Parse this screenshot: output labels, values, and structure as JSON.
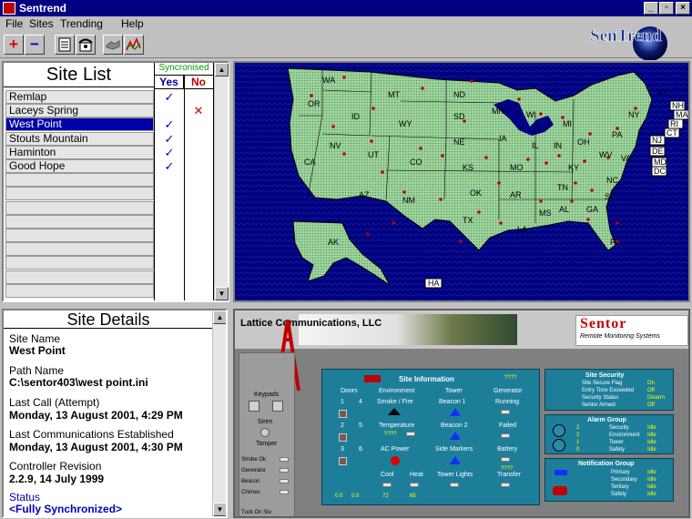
{
  "window": {
    "title": "Sentrend"
  },
  "menu": [
    "File",
    "Sites",
    "Trending",
    "Help"
  ],
  "toolbar": {
    "add": "+",
    "remove": "−"
  },
  "brand": "SenTrend",
  "site_list": {
    "title": "Site List",
    "sync_header": "Syncronised",
    "yes_label": "Yes",
    "no_label": "No",
    "sites": [
      {
        "name": "Remlap",
        "sync": "yes"
      },
      {
        "name": "Laceys Spring",
        "sync": "no"
      },
      {
        "name": "West Point",
        "sync": "yes",
        "selected": true
      },
      {
        "name": "Stouts Mountain",
        "sync": "yes"
      },
      {
        "name": "Haminton",
        "sync": "yes"
      },
      {
        "name": "Good Hope",
        "sync": "yes"
      }
    ],
    "check_glyph": "✓",
    "cross_glyph": "✕"
  },
  "map": {
    "states": [
      "WA",
      "OR",
      "ID",
      "MT",
      "ND",
      "SD",
      "MN",
      "WI",
      "MI",
      "NY",
      "VT",
      "NH",
      "MA",
      "RI",
      "CT",
      "NJ",
      "DE",
      "MD",
      "DC",
      "CA",
      "NV",
      "UT",
      "WY",
      "NE",
      "IA",
      "IL",
      "IN",
      "OH",
      "PA",
      "WV",
      "VA",
      "KY",
      "CO",
      "KS",
      "MO",
      "TN",
      "NC",
      "SC",
      "GA",
      "AL",
      "MS",
      "AR",
      "OK",
      "TX",
      "LA",
      "FL",
      "AZ",
      "NM",
      "AK",
      "HA"
    ],
    "land_color": "#9bd19a",
    "water_color": "#000080"
  },
  "site_details": {
    "title": "Site Details",
    "site_name_label": "Site Name",
    "site_name": "West Point",
    "path_name_label": "Path Name",
    "path_name": "C:\\sentor403\\west point.ini",
    "last_call_label": "Last Call (Attempt)",
    "last_call": "Monday, 13 August 2001, 4:29 PM",
    "last_comm_label": "Last Communications Established",
    "last_comm": "Monday, 13 August 2001, 4:30 PM",
    "controller_label": "Controller Revision",
    "controller": "2.2.9, 14 July 1999",
    "status_label": "Status",
    "status": "<Fully Synchronized>"
  },
  "remote": {
    "company": "Lattice Communications, LLC",
    "logo": "Sentor",
    "logo_sub": "Remote Monitoring Systems",
    "side": {
      "keypads": "Keypads",
      "siren": "Siren",
      "tamper": "Tamper",
      "rows": [
        "Strobe Ok",
        "Generator",
        "Beacon",
        "Chimes"
      ],
      "foot": "Tuck On Sto"
    },
    "site_info": {
      "title": "Site Information",
      "q": "????",
      "headers": [
        "Doors",
        "Environment",
        "Tower",
        "Generator"
      ],
      "smoke": "Smoke / Fire",
      "beacon1": "Beacon 1",
      "running": "Running",
      "temperature": "Temperature",
      "beacon2": "Beacon 2",
      "failed": "Failed",
      "ac_power": "AC Power",
      "side_markers": "Side Markers",
      "battery": "Battery",
      "cool": "Cool",
      "heat": "Heat",
      "tower_lights": "Tower Lights",
      "transfer": "Transfer",
      "door_nums": [
        "1",
        "4",
        "2",
        "5",
        "3",
        "6"
      ],
      "bottom_vals": [
        "0.0",
        "0.0",
        "72",
        "65"
      ]
    },
    "site_security": {
      "title": "Site Security",
      "rows": [
        {
          "label": "Site Secure Flag",
          "value": "On"
        },
        {
          "label": "Entry Time Exceeded",
          "value": "Off"
        },
        {
          "label": "Security Status",
          "value": "Disarm"
        },
        {
          "label": "Sentor Armed",
          "value": "Off"
        }
      ]
    },
    "alarm_group": {
      "title": "Alarm Group",
      "rows": [
        {
          "num": "2",
          "label": "Security",
          "value": "Idle"
        },
        {
          "num": "2",
          "label": "Environment",
          "value": "Idle"
        },
        {
          "num": "1",
          "label": "Tower",
          "value": "Idle"
        },
        {
          "num": "0",
          "label": "Safety",
          "value": "Idle"
        }
      ]
    },
    "notification_group": {
      "title": "Notification Group",
      "rows": [
        {
          "label": "Primary",
          "value": "Idle"
        },
        {
          "label": "Secondary",
          "value": "Idle"
        },
        {
          "label": "Tertiary",
          "value": "Idle"
        },
        {
          "label": "Safety",
          "value": "Idle"
        }
      ]
    }
  }
}
